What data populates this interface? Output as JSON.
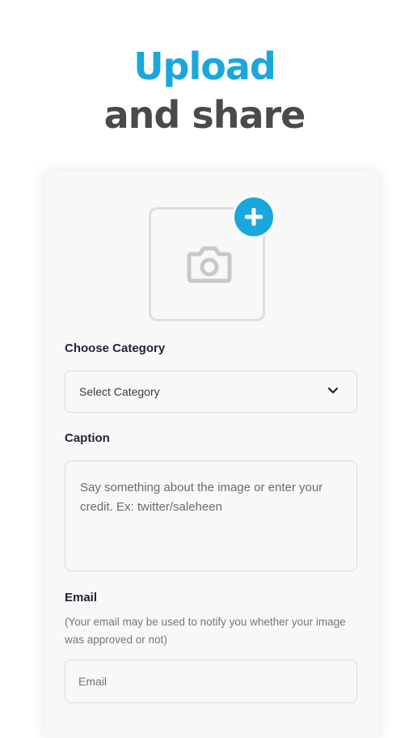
{
  "hero": {
    "line1": "Upload",
    "line2": "and share",
    "colors": {
      "accent": "#1aa7dc",
      "secondary": "#4a4a4a"
    }
  },
  "form": {
    "upload": {
      "image_icon": "camera-icon",
      "add_icon": "plus-icon"
    },
    "category": {
      "label": "Choose Category",
      "selected": "Select Category",
      "icon": "chevron-down-icon"
    },
    "caption": {
      "label": "Caption",
      "placeholder": "Say something about the image or enter your credit. Ex: twitter/saleheen"
    },
    "email": {
      "label": "Email",
      "note": "(Your email may be used to notify you whether your image was approved or not)",
      "placeholder": "Email"
    }
  }
}
